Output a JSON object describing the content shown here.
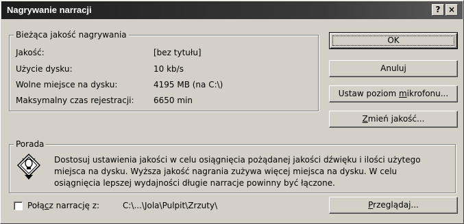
{
  "window": {
    "title": "Nagrywanie narracji",
    "help_btn": "?",
    "close_btn": "×"
  },
  "quality_group": {
    "legend": "Bieżąca jakość nagrywania",
    "rows": [
      {
        "label": "Jakość:",
        "value": "[bez tytułu]"
      },
      {
        "label": "Użycie dysku:",
        "value": "10 kb/s"
      },
      {
        "label": "Wolne miejsce na dysku:",
        "value": "4195 MB (na C:\\)"
      },
      {
        "label": "Maksymalny czas rejestracji:",
        "value": "6650 min"
      }
    ]
  },
  "buttons": {
    "ok": "OK",
    "cancel": "Anuluj",
    "mic_level_pre": "Ustaw poziom ",
    "mic_level_key": "m",
    "mic_level_post": "ikrofonu...",
    "change_quality_pre": "",
    "change_quality_key": "Z",
    "change_quality_post": "mień jakość...",
    "browse_pre": "",
    "browse_key": "P",
    "browse_post": "rzeglądaj..."
  },
  "tip_group": {
    "legend": "Porada",
    "text_lines": [
      "Dostosuj ustawienia jakości w celu osiągnięcia pożądanej jakości dźwięku i ilości użytego",
      "miejsca na dysku. Wyższa jakość nagrania zużywa więcej miejsca na dysku. W celu",
      "osiągnięcia lepszej wydajności długie narracje powinny być łączone."
    ],
    "icon": "tip-lightbulb-icon"
  },
  "link_option": {
    "label_pre": "Połą",
    "label_key": "c",
    "label_post": "z narrację z:",
    "checked": false,
    "path": "C:\\...\\Jola\\Pulpit\\Zrzuty\\"
  }
}
